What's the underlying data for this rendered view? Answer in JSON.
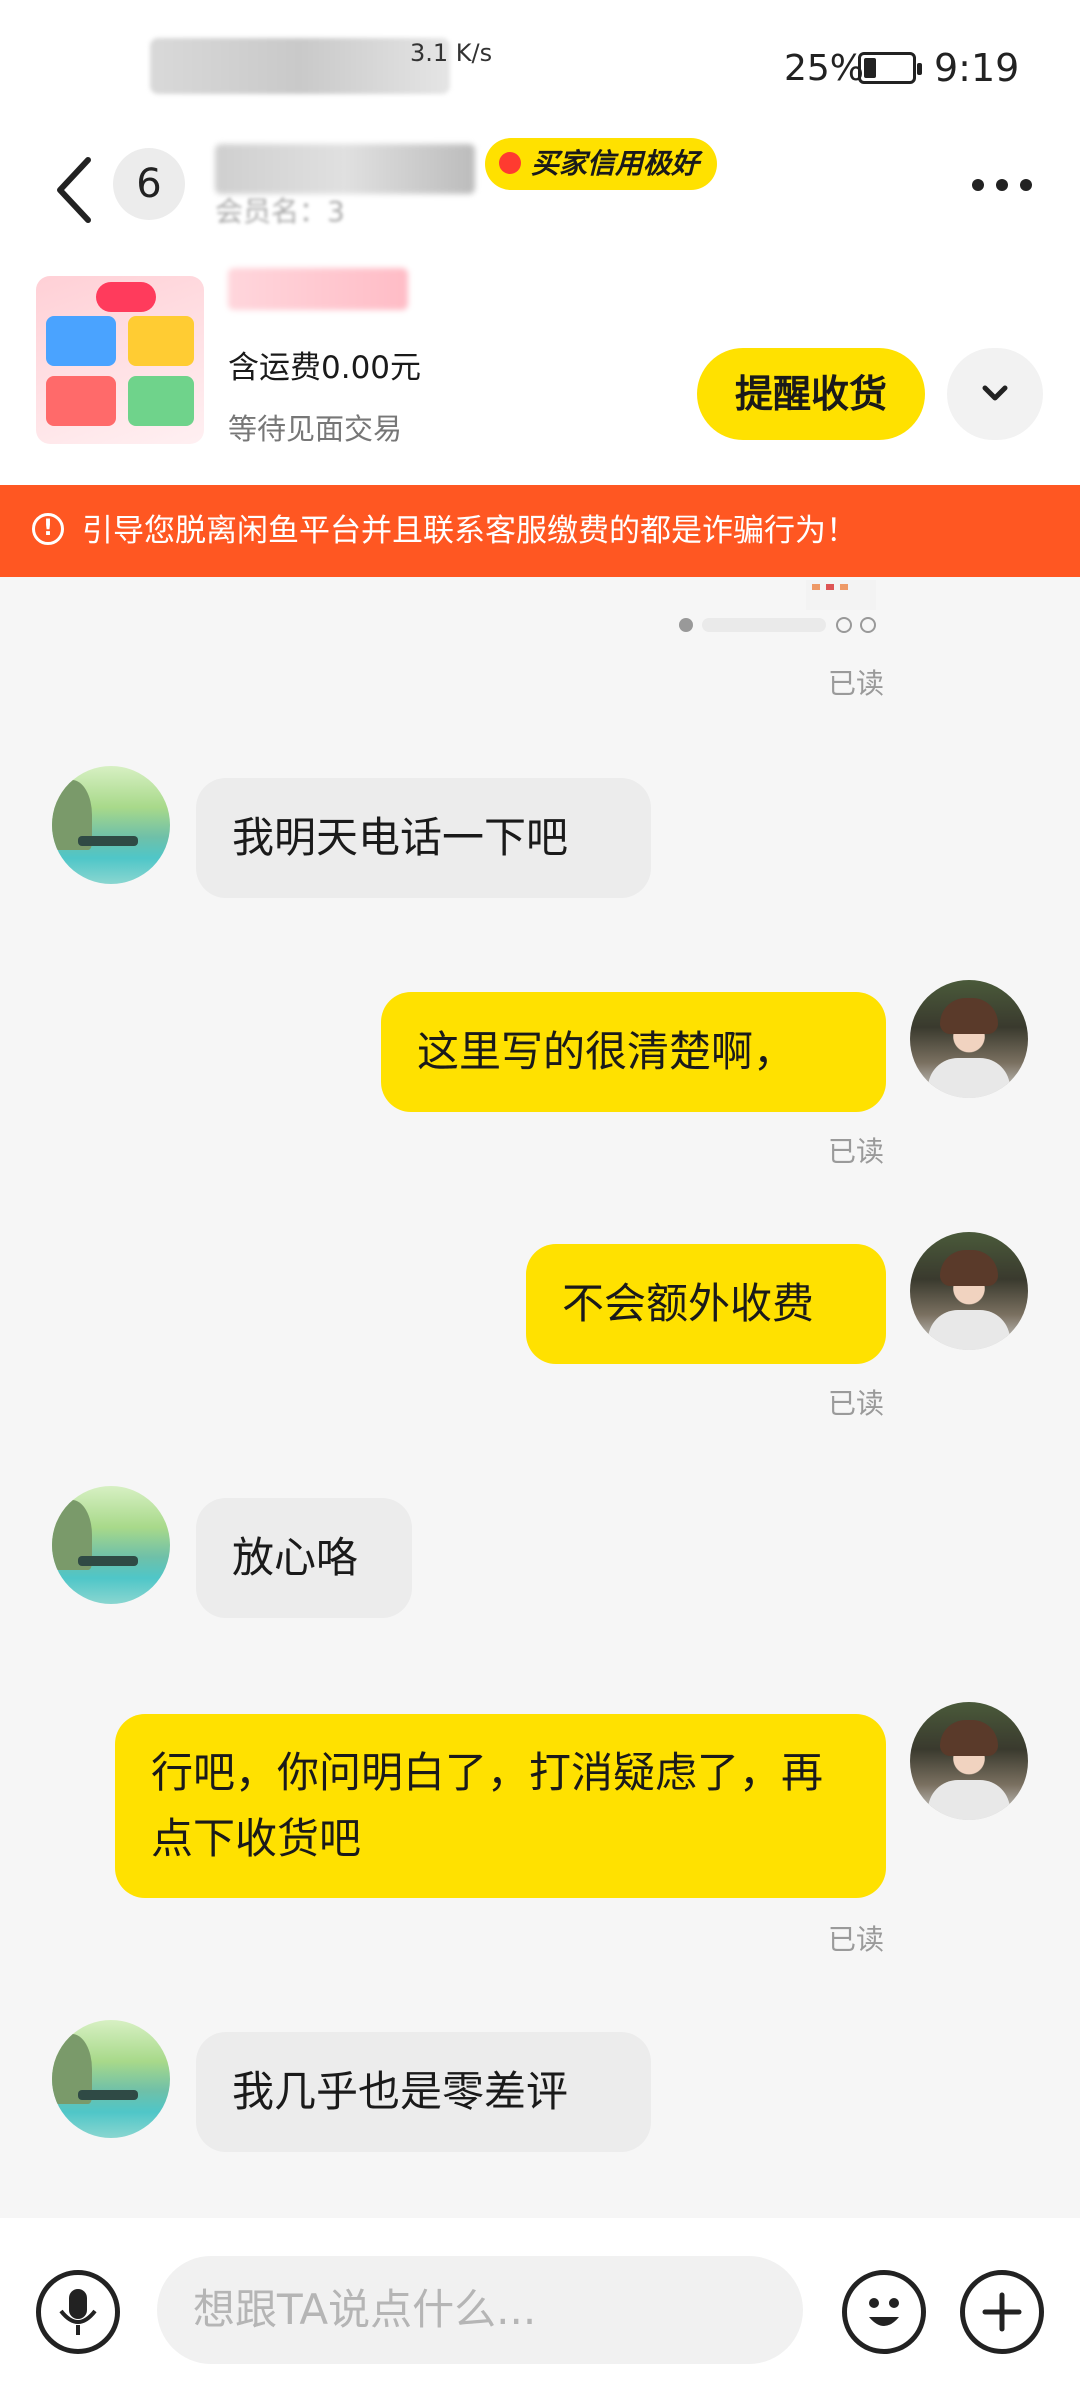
{
  "status_bar": {
    "network_speed": "3.1 K/s",
    "battery_percent": "25%",
    "battery_level": 0.25,
    "time": "9:19"
  },
  "header": {
    "unread_count": "6",
    "credit_badge": "买家信用极好",
    "credit_sub": "会员名：3"
  },
  "order": {
    "price_text": "含运费0.00元",
    "status_text": "等待见面交易",
    "remind_button": "提醒收货"
  },
  "warning": {
    "icon": "!",
    "text": "引导您脱离闲鱼平台并且联系客服缴费的都是诈骗行为！"
  },
  "messages": [
    {
      "from": "self",
      "type": "image",
      "read": "已读"
    },
    {
      "from": "other",
      "text": "我明天电话一下吧"
    },
    {
      "from": "self",
      "text": "这里写的很清楚啊，",
      "read": "已读"
    },
    {
      "from": "self",
      "text": "不会额外收费",
      "read": "已读"
    },
    {
      "from": "other",
      "text": "放心咯"
    },
    {
      "from": "self",
      "text": "行吧，你问明白了，打消疑虑了，再点下收货吧",
      "read": "已读"
    },
    {
      "from": "other",
      "text": "我几乎也是零差评"
    }
  ],
  "input": {
    "placeholder": "想跟TA说点什么..."
  },
  "icons": {
    "back": "chevron-left-icon",
    "more": "more-dots-icon",
    "expand": "chevron-down-icon",
    "mic": "microphone-icon",
    "emoji": "emoji-icon",
    "plus": "plus-icon"
  },
  "colors": {
    "accent": "#ffe100",
    "warning": "#ff5722"
  }
}
